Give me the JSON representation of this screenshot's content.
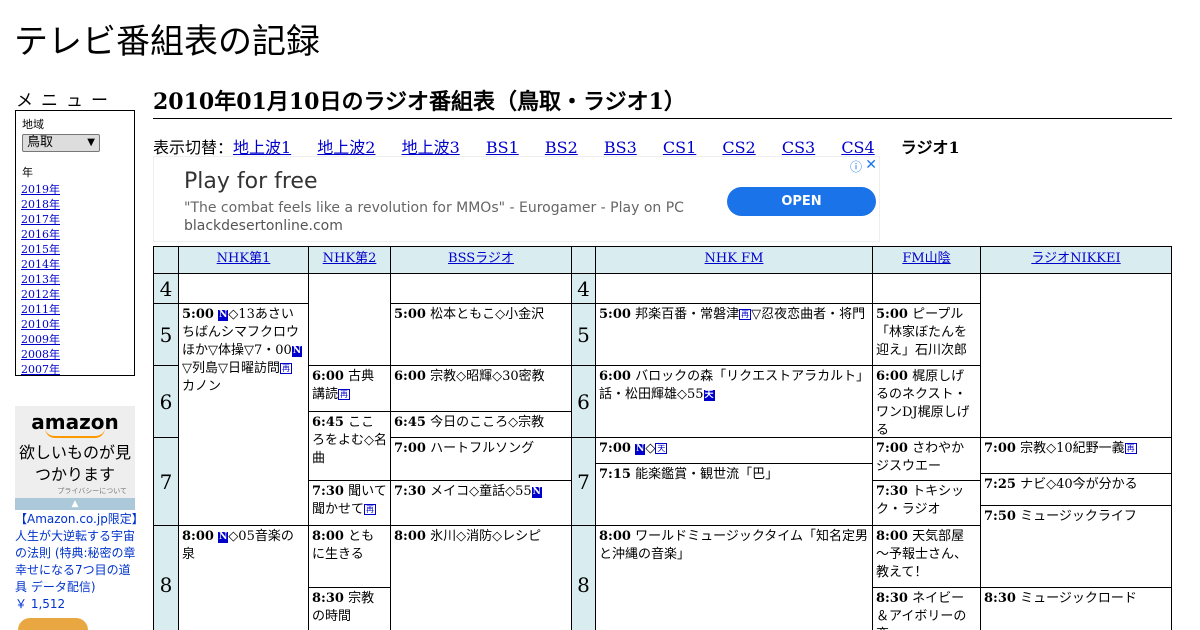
{
  "site_title": "テレビ番組表の記録",
  "menu": {
    "title": "メニュー",
    "region_label": "地域",
    "region_value": "鳥取",
    "year_label": "年",
    "years": [
      "2019年",
      "2018年",
      "2017年",
      "2016年",
      "2015年",
      "2014年",
      "2013年",
      "2012年",
      "2011年",
      "2010年",
      "2009年",
      "2008年",
      "2007年"
    ]
  },
  "side_ad": {
    "logo": "amazon",
    "tagline": "欲しいものが見つかります",
    "privacy": "プライバシーについて",
    "product": "【Amazon.co.jp限定】人生が大逆転する宇宙の法則 (特典:秘密の章 幸せになる7つ目の道具 データ配信)",
    "price": "￥ 1,512"
  },
  "page_heading": "2010年01月10日のラジオ番組表（鳥取・ラジオ1）",
  "switcher": {
    "label": "表示切替：",
    "links": [
      "地上波1",
      "地上波2",
      "地上波3",
      "BS1",
      "BS2",
      "BS3",
      "CS1",
      "CS2",
      "CS3",
      "CS4"
    ],
    "current": "ラジオ1"
  },
  "main_ad": {
    "title": "Play for free",
    "desc": "\"The combat feels like a revolution for MMOs\" - Eurogamer - Play on PC",
    "url": "blackdesertonline.com",
    "button": "OPEN"
  },
  "channels": [
    "NHK第1",
    "NHK第2",
    "BSSラジオ",
    "NHK FM",
    "FM山陰",
    "ラジオNIKKEI"
  ],
  "hours": [
    "4",
    "5",
    "6",
    "7",
    "8"
  ],
  "programs": {
    "nhk1_5": {
      "time": "5:00",
      "text": "◇13あさいちばんシマフクロウほか▽体操▽7・00",
      "text2": "▽列島▽日曜訪問",
      "text3": "カノン"
    },
    "nhk1_8": {
      "time": "8:00",
      "text": "◇05音楽の泉"
    },
    "nhk2_600": {
      "time": "6:00",
      "text": "古典講読"
    },
    "nhk2_645": {
      "time": "6:45",
      "text": "こころをよむ◇名曲"
    },
    "nhk2_730": {
      "time": "7:30",
      "text": "聞いて聞かせて"
    },
    "nhk2_800": {
      "time": "8:00",
      "text": "ともに生きる"
    },
    "nhk2_830": {
      "time": "8:30",
      "text": "宗教の時間"
    },
    "bss_500": {
      "time": "5:00",
      "text": "松本ともこ◇小金沢"
    },
    "bss_600": {
      "time": "6:00",
      "text": "宗教◇昭輝◇30密教"
    },
    "bss_645": {
      "time": "6:45",
      "text": "今日のこころ◇宗教"
    },
    "bss_700": {
      "time": "7:00",
      "text": "ハートフルソング"
    },
    "bss_730": {
      "time": "7:30",
      "text": "メイコ◇童話◇55"
    },
    "bss_800": {
      "time": "8:00",
      "text": "氷川◇消防◇レシピ"
    },
    "fm_500": {
      "time": "5:00",
      "text": "邦楽百番・常磐津",
      "text2": "▽忍夜恋曲者・将門"
    },
    "fm_600": {
      "time": "6:00",
      "text": "バロックの森「リクエストアラカルト」話・松田輝雄◇55"
    },
    "fm_700": {
      "time": "7:00",
      "text": "◇"
    },
    "fm_715": {
      "time": "7:15",
      "text": "能楽鑑賞・観世流「巴」"
    },
    "fm_800": {
      "time": "8:00",
      "text": "ワールドミュージックタイム「知名定男と沖縄の音楽」"
    },
    "fms_500": {
      "time": "5:00",
      "text": "ピープル「林家ぼたんを迎え」石川次郎"
    },
    "fms_600": {
      "time": "6:00",
      "text": "梶原しげるのネクスト・ワンDJ梶原しげる"
    },
    "fms_700": {
      "time": "7:00",
      "text": "さわやかジスウエー"
    },
    "fms_730": {
      "time": "7:30",
      "text": "トキシック・ラジオ"
    },
    "fms_800": {
      "time": "8:00",
      "text": "天気部屋～予報士さん、教えて！"
    },
    "fms_830": {
      "time": "8:30",
      "text": "ネイビー＆アイボリーの恋"
    },
    "nk_700": {
      "time": "7:00",
      "text": "宗教◇10紀野一義"
    },
    "nk_725": {
      "time": "7:25",
      "text": "ナビ◇40今が分かる"
    },
    "nk_750": {
      "time": "7:50",
      "text": "ミュージックライフ"
    },
    "nk_830": {
      "time": "8:30",
      "text": "ミュージックロード"
    }
  },
  "marks": {
    "n": "N",
    "re": "再",
    "ten": "天"
  }
}
